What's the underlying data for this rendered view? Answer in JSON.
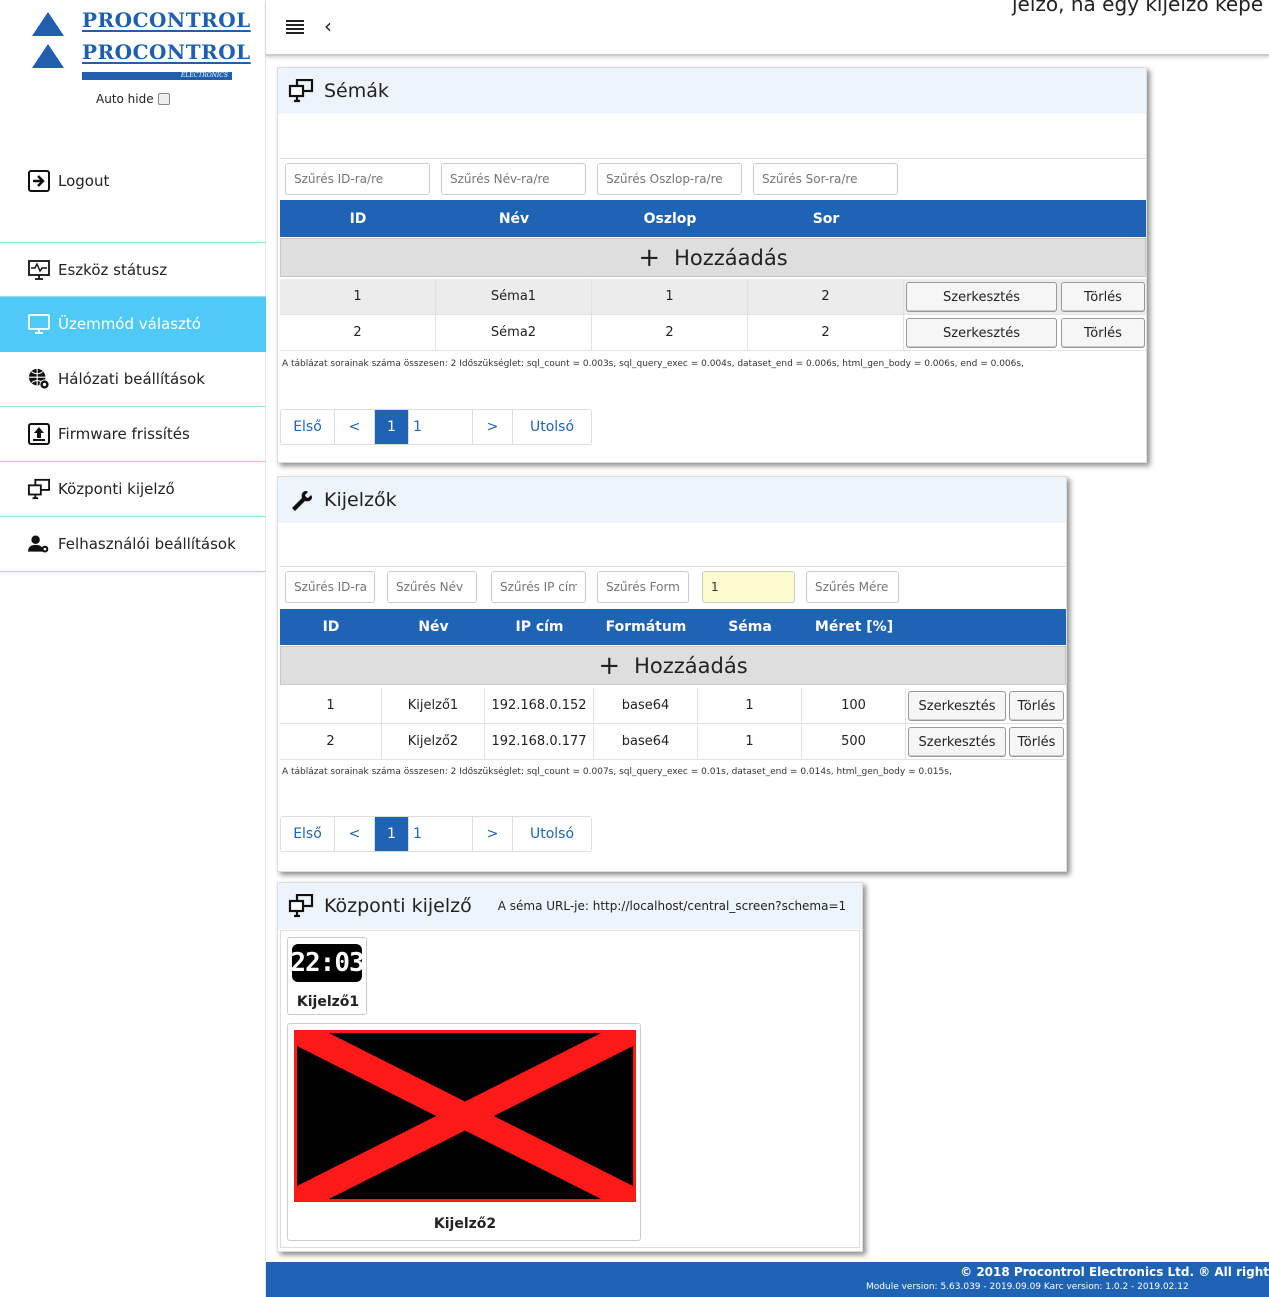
{
  "brand": {
    "name": "PROCONTROL",
    "sub": "ELECTRONICS"
  },
  "sidebar": {
    "autohide_label": "Auto hide",
    "logout_label": "Logout",
    "items": [
      {
        "label": "Eszköz státusz",
        "icon": "monitor-heartbeat-icon"
      },
      {
        "label": "Üzemmód választó",
        "icon": "monitor-icon"
      },
      {
        "label": "Hálózati beállítások",
        "icon": "globe-gear-icon"
      },
      {
        "label": "Firmware frissítés",
        "icon": "upload-icon"
      },
      {
        "label": "Központi kijelző",
        "icon": "screens-icon"
      },
      {
        "label": "Felhasználói beállítások",
        "icon": "user-gear-icon"
      }
    ]
  },
  "topbar": {
    "text": "jelző, ha egy kijelző képe"
  },
  "schemas": {
    "title": "Sémák",
    "filters": [
      "Szűrés ID-ra/re",
      "Szűrés Név-ra/re",
      "Szűrés Oszlop-ra/re",
      "Szűrés Sor-ra/re"
    ],
    "columns": [
      "ID",
      "Név",
      "Oszlop",
      "Sor"
    ],
    "add_label": "Hozzáadás",
    "rows": [
      {
        "id": "1",
        "name": "Séma1",
        "col": "1",
        "row": "2"
      },
      {
        "id": "2",
        "name": "Séma2",
        "col": "2",
        "row": "2"
      }
    ],
    "edit_label": "Szerkesztés",
    "delete_label": "Törlés",
    "info": "A táblázat sorainak száma összesen: 2   Időszükséglet: sql_count = 0.003s, sql_query_exec = 0.004s, dataset_end = 0.006s, html_gen_body = 0.006s, end = 0.006s,",
    "pager": {
      "first": "Első",
      "prev": "<",
      "current": "1",
      "total": "1",
      "next": ">",
      "last": "Utolsó"
    }
  },
  "displays": {
    "title": "Kijelzők",
    "filters": [
      "Szűrés ID-ra",
      "Szűrés Név",
      "Szűrés IP cím",
      "Szűrés Form",
      "1",
      "Szűrés Mére"
    ],
    "columns": [
      "ID",
      "Név",
      "IP cím",
      "Formátum",
      "Séma",
      "Méret [%]"
    ],
    "add_label": "Hozzáadás",
    "rows": [
      {
        "id": "1",
        "name": "Kijelző1",
        "ip": "192.168.0.152",
        "format": "base64",
        "schema": "1",
        "size": "100"
      },
      {
        "id": "2",
        "name": "Kijelző2",
        "ip": "192.168.0.177",
        "format": "base64",
        "schema": "1",
        "size": "500"
      }
    ],
    "edit_label": "Szerkesztés",
    "delete_label": "Törlés",
    "info": "A táblázat sorainak száma összesen: 2   Időszükséglet: sql_count = 0.007s, sql_query_exec = 0.01s, dataset_end = 0.014s, html_gen_body = 0.015s,",
    "pager": {
      "first": "Első",
      "prev": "<",
      "current": "1",
      "total": "1",
      "next": ">",
      "last": "Utolsó"
    }
  },
  "central": {
    "title": "Központi kijelző",
    "url_text": "A séma URL-je: http://localhost/central_screen?schema=1",
    "tiles": [
      {
        "label": "Kijelző1",
        "clock": "22:03"
      },
      {
        "label": "Kijelző2"
      }
    ],
    "colors": {
      "cross": "#ff1a1a",
      "screen_bg": "#000000"
    }
  },
  "footer": {
    "copyright": "© 2018 Procontrol Electronics Ltd. ® All right",
    "versions": "Module version: 5.63.039 - 2019.09.09     Karc version: 1.0.2 - 2019.02.12"
  },
  "colors": {
    "accent": "#1f63b5",
    "active_nav": "#4fc9f5",
    "panel_head": "#edf4fb"
  }
}
